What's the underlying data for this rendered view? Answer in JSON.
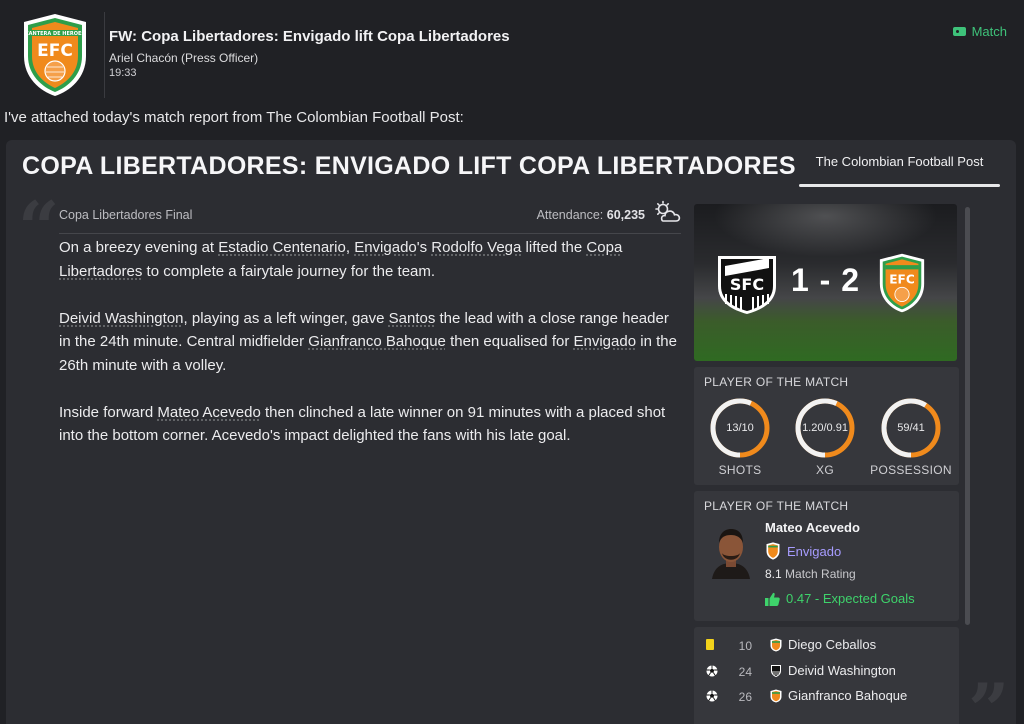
{
  "header": {
    "title": "FW: Copa Libertadores: Envigado lift Copa Libertadores",
    "author": "Ariel Chacón  (Press Officer)",
    "time": "19:33",
    "match_link": "Match",
    "crest_banner": "CANTERA DE HEROES",
    "crest_letters": "EFC"
  },
  "intro": "I've attached today's match report from The Colombian Football Post:",
  "article": {
    "headline": "COPA LIBERTADORES: ENVIGADO LIFT COPA LIBERTADORES",
    "source": "The Colombian Football Post",
    "competition": "Copa Libertadores Final",
    "attendance_label": "Attendance:",
    "attendance_value": "60,235",
    "weather_icon": "partly-cloudy-icon",
    "p1": {
      "a": "On a breezy evening at ",
      "venue": "Estadio Centenario",
      "b": ", ",
      "club": "Envigado",
      "c": "'s ",
      "manager": "Rodolfo Vega",
      "d": " lifted the ",
      "comp": "Copa Libertadores",
      "e": " to complete a fairytale journey for the team."
    },
    "p2": {
      "player1": "Deivid Washington",
      "a": ", playing as a left winger, gave ",
      "club1": "Santos",
      "b": " the lead with a close range header in the 24th minute. Central midfielder ",
      "player2": "Gianfranco Bahoque",
      "c": " then equalised for ",
      "club2": "Envigado",
      "d": " in the 26th minute with a volley."
    },
    "p3": {
      "a": "Inside forward ",
      "player": "Mateo Acevedo",
      "b": " then clinched a late winner on 91 minutes with a placed shot into the bottom corner. Acevedo's impact delighted the fans with his late goal."
    }
  },
  "score": "1 - 2",
  "home_crest_letters": "SFC",
  "stats": {
    "label": "PLAYER OF THE MATCH",
    "items": [
      {
        "value": "13/10",
        "caption": "SHOTS",
        "home_share": 0.565
      },
      {
        "value": "1.20/0.91",
        "caption": "XG",
        "home_share": 0.569
      },
      {
        "value": "59/41",
        "caption": "POSSESSION",
        "home_share": 0.59
      }
    ],
    "colors": {
      "home": "#f2f2f2",
      "away": "#f08a1c"
    }
  },
  "potm": {
    "label": "PLAYER OF THE MATCH",
    "name": "Mateo Acevedo",
    "club": "Envigado",
    "rating_value": "8.1",
    "rating_label": "Match Rating",
    "xg_text": "0.47 - Expected Goals"
  },
  "events": [
    {
      "icon": "yellow-card-icon",
      "minute": "10",
      "club": "envigado",
      "player": "Diego Ceballos"
    },
    {
      "icon": "goal-ball-icon",
      "minute": "24",
      "club": "santos",
      "player": "Deivid Washington"
    },
    {
      "icon": "goal-ball-icon",
      "minute": "26",
      "club": "envigado",
      "player": "Gianfranco Bahoque"
    }
  ]
}
